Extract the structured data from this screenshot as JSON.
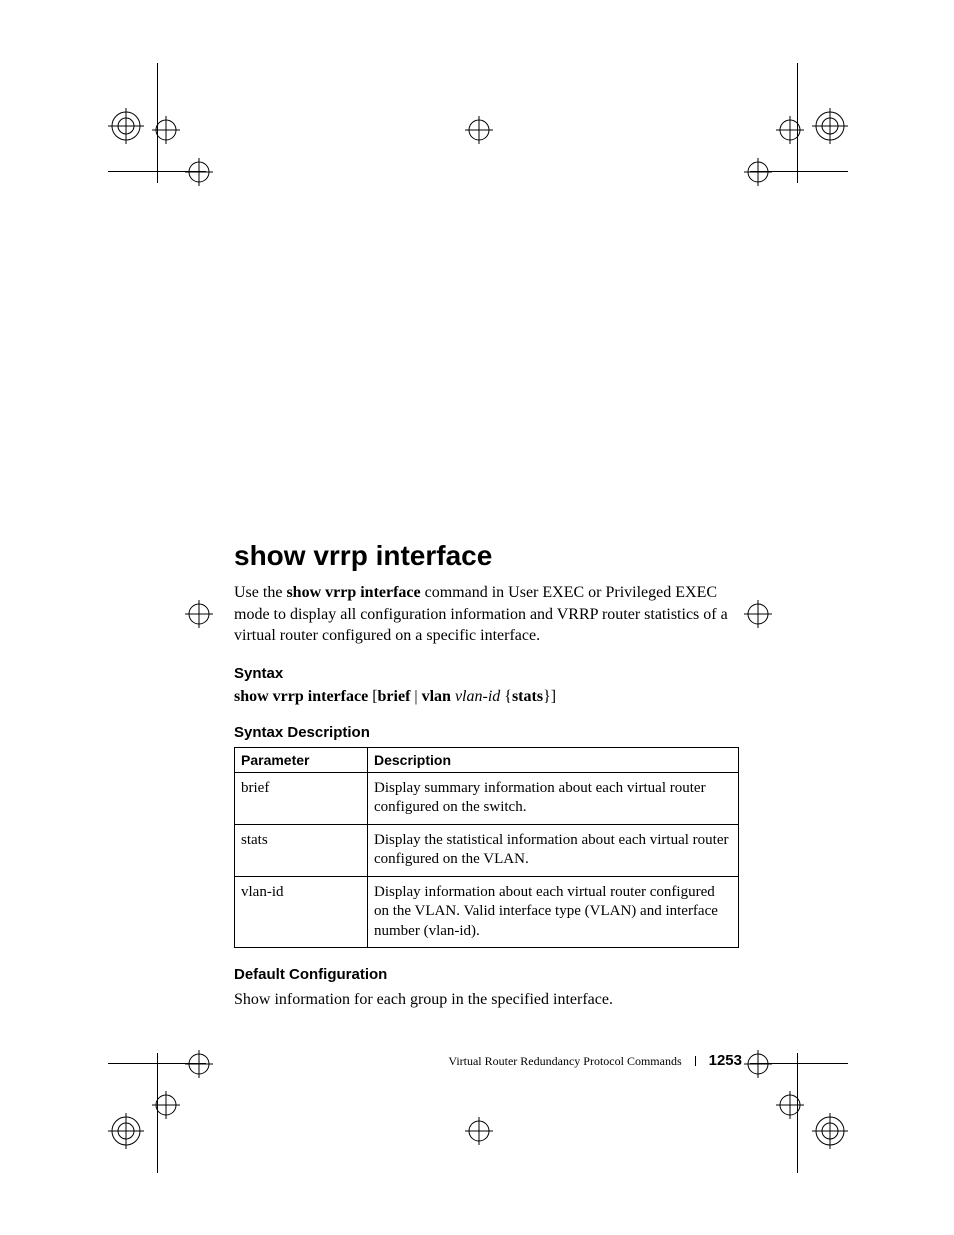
{
  "heading": "show vrrp interface",
  "intro_pre": "Use the ",
  "intro_cmd": "show vrrp interface",
  "intro_post": " command in User EXEC or Privileged EXEC mode to display all configuration information and VRRP router statistics of a virtual router configured on a specific interface.",
  "syntax_heading": "Syntax",
  "syntax_cmd": "show vrrp interface",
  "syntax_mid1": " [",
  "syntax_brief": "brief",
  "syntax_pipe": " | ",
  "syntax_vlan": "vlan",
  "syntax_space": " ",
  "syntax_vlanid": "vlan-id",
  "syntax_mid2": " {",
  "syntax_stats": "stats",
  "syntax_end": "}]",
  "syntax_desc_heading": "Syntax Description",
  "table": {
    "h1": "Parameter",
    "h2": "Description",
    "rows": [
      {
        "p": "brief",
        "d": "Display summary information about each virtual router configured on the switch."
      },
      {
        "p": "stats",
        "d": "Display the statistical information about each virtual router configured on the VLAN."
      },
      {
        "p": "vlan-id",
        "d": "Display information about each virtual router configured on the VLAN. Valid interface type (VLAN) and interface number (vlan-id)."
      }
    ]
  },
  "default_cfg_heading": "Default Configuration",
  "default_cfg_body": "Show information for each group in the specified interface.",
  "footer_title": "Virtual Router Redundancy Protocol Commands",
  "footer_page": "1253"
}
